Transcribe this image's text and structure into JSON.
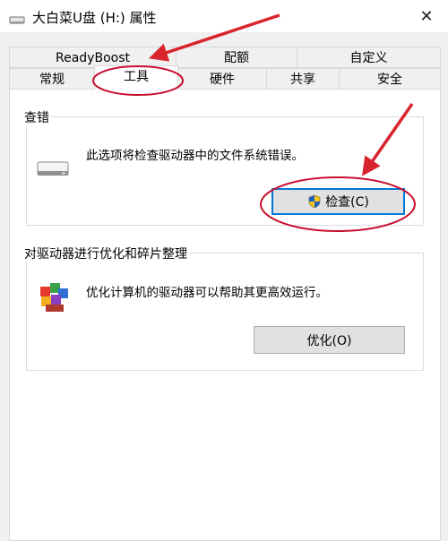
{
  "window": {
    "title": "大白菜U盘 (H:) 属性",
    "close_glyph": "✕"
  },
  "tabs_row1": [
    {
      "label": "ReadyBoost"
    },
    {
      "label": "配额"
    },
    {
      "label": "自定义"
    }
  ],
  "tabs_row2": [
    {
      "label": "常规"
    },
    {
      "label": "工具"
    },
    {
      "label": "硬件"
    },
    {
      "label": "共享"
    },
    {
      "label": "安全"
    }
  ],
  "active_tab": "工具",
  "error_check": {
    "group_label": "查错",
    "description": "此选项将检查驱动器中的文件系统错误。",
    "button_label": "检查(C)"
  },
  "optimize": {
    "group_label": "对驱动器进行优化和碎片整理",
    "description": "优化计算机的驱动器可以帮助其更高效运行。",
    "button_label": "优化(O)"
  },
  "annotations": {
    "arrow_color": "#d9232d",
    "circle_color": "#c8102e"
  }
}
